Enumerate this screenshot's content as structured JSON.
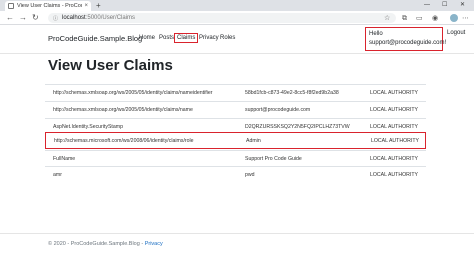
{
  "browser": {
    "tab_title": "View User Claims - ProCodeGuid",
    "new_tab": "+",
    "window_minimize": "—",
    "window_maximize": "☐",
    "window_close": "✕",
    "url_host": "localhost",
    "url_rest": ":5000/User/Claims",
    "icons": [
      "back-icon",
      "forward-icon",
      "refresh-icon",
      "lock-icon",
      "favorites-star-icon",
      "extensions-icon",
      "profile-avatar-icon",
      "more-icon"
    ]
  },
  "navbar": {
    "brand": "ProCodeGuide.Sample.Blog",
    "links": [
      "Home",
      "Posts",
      "Claims",
      "Privacy",
      "Roles"
    ],
    "hello": "Hello",
    "user_email": "support@procodeguide.com!",
    "logout": "Logout"
  },
  "main": {
    "title": "View User Claims",
    "claims": [
      {
        "type": "http://schemas.xmlsoap.org/ws/2005/05/identity/claims/nameidentifier",
        "value": "58bd1fcb-c873-49e2-8cc5-f8f2ed9b2a38",
        "issuer": "LOCAL AUTHORITY"
      },
      {
        "type": "http://schemas.xmlsoap.org/ws/2005/05/identity/claims/name",
        "value": "support@procodeguide.com",
        "issuer": "LOCAL AUTHORITY"
      },
      {
        "type": "AspNet.Identity.SecurityStamp",
        "value": "D2QRZURSSKSQ2Y2N5FQ2IPCLHZ73TVW",
        "issuer": "LOCAL AUTHORITY"
      },
      {
        "type": "http://schemas.microsoft.com/ws/2008/06/identity/claims/role",
        "value": "Admin",
        "issuer": "LOCAL AUTHORITY"
      },
      {
        "type": "FullName",
        "value": "Support Pro Code Guide",
        "issuer": "LOCAL AUTHORITY"
      },
      {
        "type": "amr",
        "value": "pwd",
        "issuer": "LOCAL AUTHORITY"
      }
    ]
  },
  "footer": {
    "text": "© 2020 - ProCodeGuide.Sample.Blog - ",
    "privacy_link": "Privacy"
  },
  "colors": {
    "highlight": "#d9232d",
    "link": "#1b6ec2"
  }
}
